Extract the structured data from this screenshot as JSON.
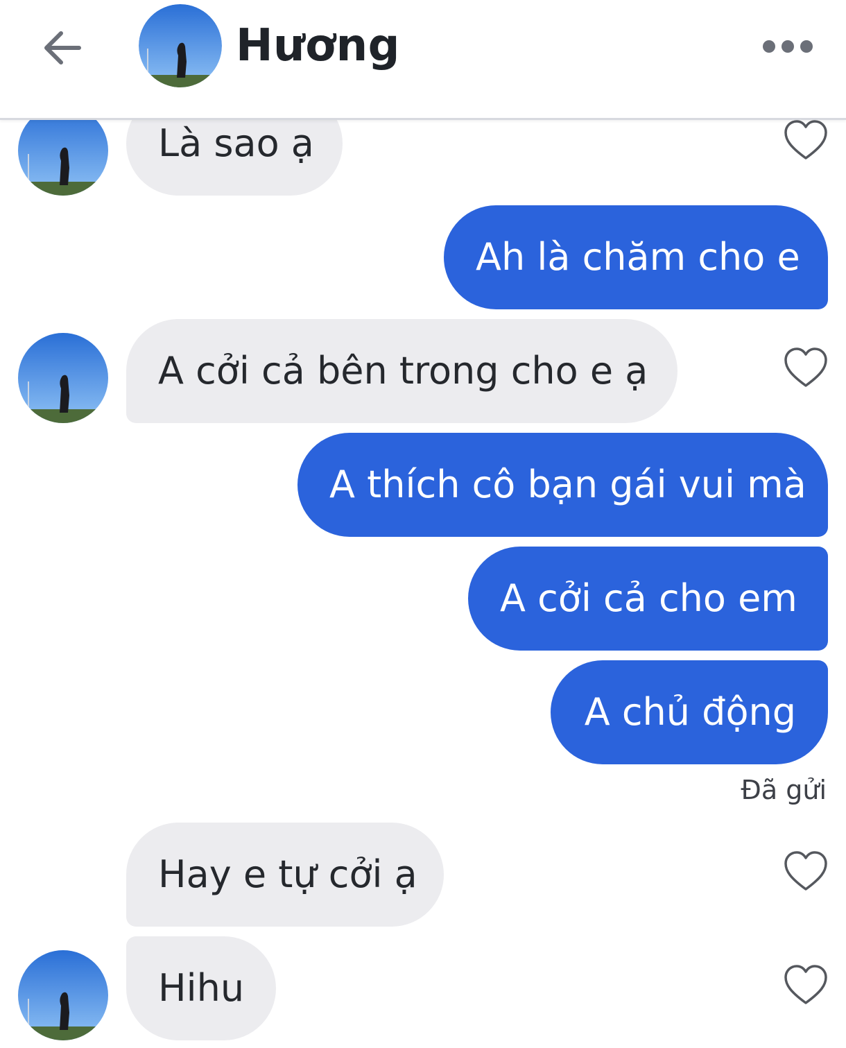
{
  "header": {
    "contact_name": "Hương"
  },
  "messages": [
    {
      "direction": "received",
      "text": "Là sao ạ"
    },
    {
      "direction": "sent",
      "text": "Ah là chăm cho e"
    },
    {
      "direction": "received",
      "text": "A cởi cả bên trong cho e ạ"
    },
    {
      "direction": "sent",
      "text": "A thích cô bạn gái vui mà"
    },
    {
      "direction": "sent",
      "text": "A cởi cả cho em"
    },
    {
      "direction": "sent",
      "text": "A chủ động"
    },
    {
      "direction": "received",
      "text": "Hay e tự cởi ạ"
    },
    {
      "direction": "received",
      "text": "Hihu"
    }
  ],
  "status": {
    "sent_label": "Đã gửi"
  },
  "colors": {
    "sent_bubble": "#2b63dc",
    "received_bubble": "#ececef",
    "text_dark": "#25282d"
  },
  "icons": [
    "back-arrow-icon",
    "more-options-icon",
    "heart-icon"
  ]
}
